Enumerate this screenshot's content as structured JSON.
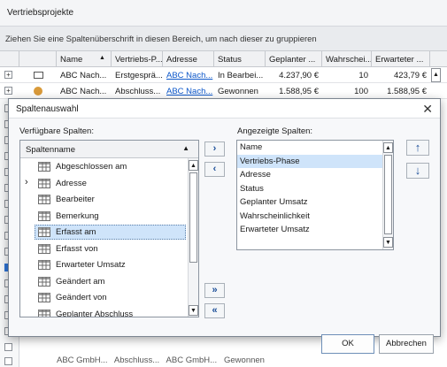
{
  "window": {
    "title": "Vertriebsprojekte"
  },
  "group_area": {
    "hint": "Ziehen Sie eine Spaltenüberschrift in diesen Bereich, um nach dieser zu gruppieren"
  },
  "grid": {
    "headers": [
      "Name",
      "Vertriebs-P...",
      "Adresse",
      "Status",
      "Geplanter ...",
      "Wahrschei...",
      "Erwarteter ..."
    ],
    "sort_indicator": "▲",
    "rows": [
      {
        "name": "ABC Nach...",
        "phase": "Erstgesprä...",
        "adresse": "ABC Nach...",
        "status": "In Bearbei...",
        "geplant": "4.237,90 €",
        "wahrsch": "10",
        "erwartet": "423,79 €"
      },
      {
        "name": "ABC Nach...",
        "phase": "Abschluss...",
        "adresse": "ABC Nach...",
        "status": "Gewonnen",
        "geplant": "1.588,95 €",
        "wahrsch": "100",
        "erwartet": "1.588,95 €"
      }
    ],
    "bottom_partial": "ABC GmbH...   Abschluss...   ABC GmbH...   Gewonnen"
  },
  "dialog": {
    "title": "Spaltenauswahl",
    "close_glyph": "✕",
    "available_label": "Verfügbare Spalten:",
    "available_header": "Spaltenname",
    "available_sort": "▲",
    "available_items": [
      {
        "label": "Abgeschlossen am",
        "expandable": false,
        "selected": false
      },
      {
        "label": "Adresse",
        "expandable": true,
        "selected": false
      },
      {
        "label": "Bearbeiter",
        "expandable": false,
        "selected": false
      },
      {
        "label": "Bemerkung",
        "expandable": false,
        "selected": false
      },
      {
        "label": "Erfasst am",
        "expandable": false,
        "selected": true
      },
      {
        "label": "Erfasst von",
        "expandable": false,
        "selected": false
      },
      {
        "label": "Erwarteter Umsatz",
        "expandable": false,
        "selected": false
      },
      {
        "label": "Geändert am",
        "expandable": false,
        "selected": false
      },
      {
        "label": "Geändert von",
        "expandable": false,
        "selected": false
      },
      {
        "label": "Geplanter Abschluss",
        "expandable": false,
        "selected": false
      }
    ],
    "displayed_label": "Angezeigte Spalten:",
    "displayed_items": [
      "Name",
      "Vertriebs-Phase",
      "Adresse",
      "Status",
      "Geplanter Umsatz",
      "Wahrscheinlichkeit",
      "Erwarteter Umsatz"
    ],
    "displayed_selected_index": 1,
    "buttons": {
      "add": "›",
      "remove": "‹",
      "add_all": "»",
      "remove_all": "«",
      "move_up": "🡑",
      "move_down": "🡓",
      "ok": "OK",
      "cancel": "Abbrechen"
    }
  }
}
